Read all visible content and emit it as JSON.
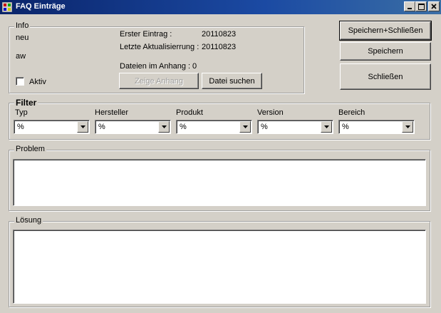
{
  "window": {
    "title": "FAQ Einträge"
  },
  "info": {
    "legend": "Info",
    "status": "neu",
    "user": "aw",
    "first_entry_label": "Erster Eintrag :",
    "first_entry_value": "20110823",
    "last_update_label": "Letzte Aktualisierrung :",
    "last_update_value": "20110823",
    "attachments_label": "Dateien im Anhang :",
    "attachments_count": "0",
    "active_label": "Aktiv",
    "show_attachment_label": "Zeige Anhang",
    "search_file_label": "Datei suchen"
  },
  "actions": {
    "save_close_label": "Speichern+Schließen",
    "save_label": "Speichern",
    "close_label": "Schließen"
  },
  "filter": {
    "legend": "Filter",
    "fields": [
      {
        "label": "Typ",
        "value": "%"
      },
      {
        "label": "Hersteller",
        "value": "%"
      },
      {
        "label": "Produkt",
        "value": "%"
      },
      {
        "label": "Version",
        "value": "%"
      },
      {
        "label": "Bereich",
        "value": "%"
      }
    ]
  },
  "problem": {
    "legend": "Problem"
  },
  "solution": {
    "legend": "Lösung"
  }
}
